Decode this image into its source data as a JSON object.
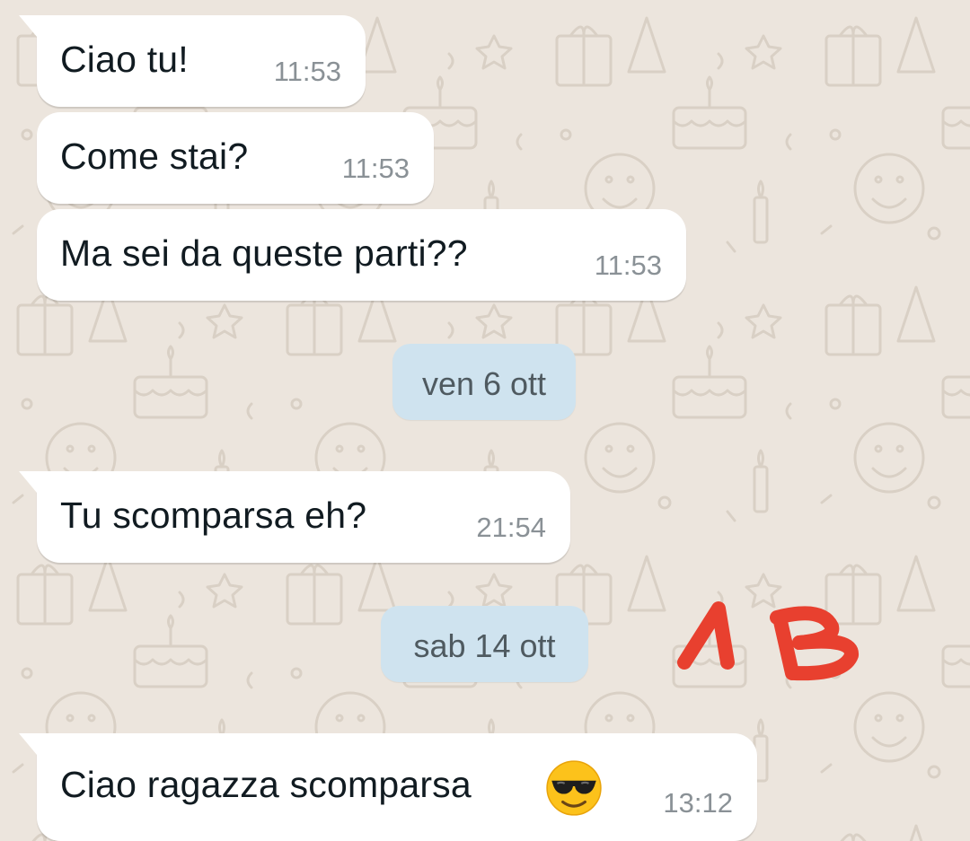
{
  "messages": [
    {
      "text": "Ciao tu!",
      "time": "11:53"
    },
    {
      "text": "Come stai?",
      "time": "11:53"
    },
    {
      "text": "Ma sei da queste parti??",
      "time": "11:53"
    },
    {
      "text": "Tu scomparsa eh?",
      "time": "21:54"
    },
    {
      "text": "Ciao ragazza scomparsa",
      "time": "13:12",
      "emoji": "smiling-face-with-sunglasses"
    }
  ],
  "date_separators": [
    "ven 6 ott",
    "sab 14 ott"
  ],
  "handwritten_annotation": "1B",
  "colors": {
    "background": "#ece5dd",
    "incoming_bubble": "#ffffff",
    "date_chip": "#cfe3ef",
    "annotation_red": "#e8402f"
  }
}
